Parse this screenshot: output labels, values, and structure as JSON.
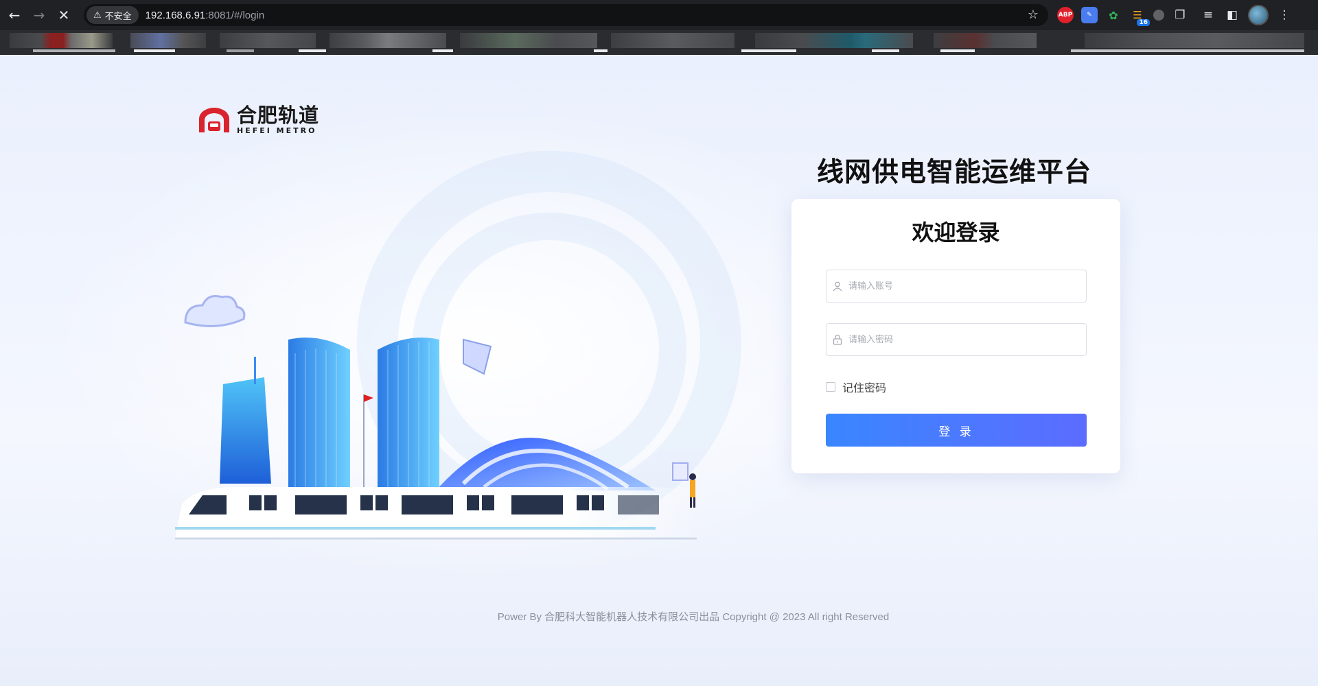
{
  "browser": {
    "security_label": "不安全",
    "url_host": "192.168.6.91",
    "url_rest": ":8081/#/login",
    "extension_badge": "16",
    "abp_label": "ABP"
  },
  "logo": {
    "cn": "合肥轨道",
    "en": "HEFEI METRO"
  },
  "platform_title": "线网供电智能运维平台",
  "login": {
    "title": "欢迎登录",
    "account_placeholder": "请输入账号",
    "password_placeholder": "请输入密码",
    "remember_label": "记住密码",
    "submit_label": "登 录"
  },
  "footer": "Power By 合肥科大智能机器人技术有限公司出品 Copyright @ 2023 All right Reserved",
  "colors": {
    "brand_red": "#d9232d",
    "button_start": "#3a86ff",
    "button_end": "#5b6cff"
  }
}
